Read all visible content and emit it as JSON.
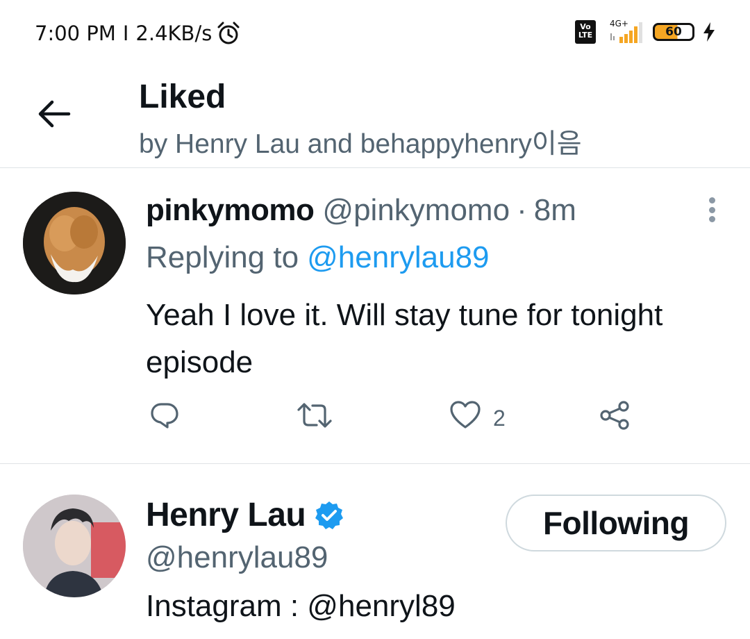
{
  "status_bar": {
    "time": "7:00 PM",
    "separator": "I",
    "speed": "2.4KB/s",
    "volte_line1": "Vo",
    "volte_line2": "LTE",
    "network": "4G+",
    "battery": "60",
    "icons": [
      "alarm-icon",
      "volte-icon",
      "signal-icon",
      "battery-icon",
      "charging-icon"
    ]
  },
  "header": {
    "title": "Liked",
    "subtitle": "by Henry Lau and behappyhenry이음",
    "back_icon": "arrow-left-icon"
  },
  "tweet": {
    "username": "pinkymomo",
    "handle": "@pinkymomo",
    "dot": "·",
    "time": "8m",
    "replying_to_label": "Replying to",
    "replying_to_mention": "@henrylau89",
    "text": "Yeah I love it. Will stay tune for tonight episode",
    "like_count": "2",
    "icons": [
      "reply-icon",
      "retweet-icon",
      "heart-icon",
      "share-icon",
      "more-icon"
    ]
  },
  "profile": {
    "name": "Henry Lau",
    "handle": "@henrylau89",
    "bio": "Instagram : @henryl89",
    "follow_button": "Following",
    "verified_icon": "verified-badge-icon"
  },
  "colors": {
    "accent": "#1d9bf0",
    "secondary_text": "#536471",
    "primary_text": "#0f1419",
    "divider": "#dfe3e6"
  }
}
